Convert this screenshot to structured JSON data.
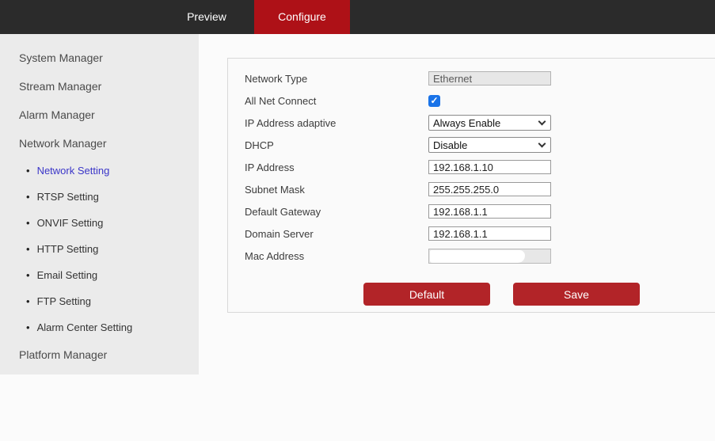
{
  "topbar": {
    "tabs": [
      {
        "label": "Preview",
        "active": false
      },
      {
        "label": "Configure",
        "active": true
      }
    ]
  },
  "sidebar": {
    "items": [
      {
        "label": "System Manager",
        "type": "section",
        "active": false
      },
      {
        "label": "Stream Manager",
        "type": "section",
        "active": false
      },
      {
        "label": "Alarm Manager",
        "type": "section",
        "active": false
      },
      {
        "label": "Network Manager",
        "type": "section",
        "active": false
      },
      {
        "label": "Network Setting",
        "type": "sub",
        "active": true
      },
      {
        "label": "RTSP Setting",
        "type": "sub",
        "active": false
      },
      {
        "label": "ONVIF Setting",
        "type": "sub",
        "active": false
      },
      {
        "label": "HTTP Setting",
        "type": "sub",
        "active": false
      },
      {
        "label": "Email Setting",
        "type": "sub",
        "active": false
      },
      {
        "label": "FTP Setting",
        "type": "sub",
        "active": false
      },
      {
        "label": "Alarm Center Setting",
        "type": "sub",
        "active": false
      },
      {
        "label": "Platform Manager",
        "type": "section",
        "active": false
      }
    ]
  },
  "form": {
    "rows": [
      {
        "name": "network-type",
        "label": "Network Type",
        "control": "text",
        "value": "Ethernet",
        "disabled": true
      },
      {
        "name": "all-net-connect",
        "label": "All Net Connect",
        "control": "checkbox",
        "checked": true
      },
      {
        "name": "ip-address-adaptive",
        "label": "IP Address adaptive",
        "control": "select",
        "value": "Always Enable"
      },
      {
        "name": "dhcp",
        "label": "DHCP",
        "control": "select",
        "value": "Disable"
      },
      {
        "name": "ip-address",
        "label": "IP Address",
        "control": "text",
        "value": "192.168.1.10",
        "disabled": false
      },
      {
        "name": "subnet-mask",
        "label": "Subnet Mask",
        "control": "text",
        "value": "255.255.255.0",
        "disabled": false
      },
      {
        "name": "default-gateway",
        "label": "Default Gateway",
        "control": "text",
        "value": "192.168.1.1",
        "disabled": false
      },
      {
        "name": "domain-server",
        "label": "Domain Server",
        "control": "text",
        "value": "192.168.1.1",
        "disabled": false
      },
      {
        "name": "mac-address",
        "label": "Mac Address",
        "control": "redacted",
        "value": ""
      }
    ],
    "buttons": [
      {
        "label": "Default"
      },
      {
        "label": "Save"
      }
    ]
  },
  "colors": {
    "topbar_bg": "#2b2b2b",
    "accent_red": "#ae1117",
    "button_red": "#b22428",
    "sidebar_bg": "#ebebeb",
    "active_link_blue": "#3a35c8",
    "checkbox_blue": "#1a73e8"
  }
}
